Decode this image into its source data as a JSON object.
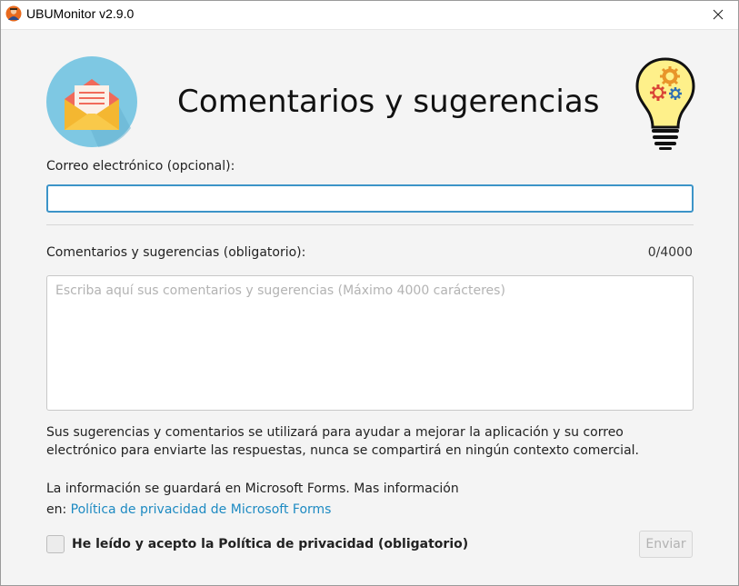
{
  "window": {
    "title": "UBUMonitor v2.9.0",
    "close_icon": "close-icon"
  },
  "header": {
    "title": "Comentarios y sugerencias",
    "left_icon": "envelope-icon",
    "right_icon": "lightbulb-gears-icon"
  },
  "form": {
    "email_label": "Correo electrónico (opcional):",
    "email_value": "",
    "comments_label": "Comentarios y sugerencias (obligatorio):",
    "counter": "0/4000",
    "comments_value": "",
    "comments_placeholder": "Escriba aquí sus comentarios y sugerencias (Máximo 4000 carácteres)",
    "notice_line1": "Sus sugerencias y comentarios se utilizará para ayudar a mejorar la aplicación y su correo",
    "notice_line2": "electrónico para enviarte las respuestas, nunca se compartirá en ningún contexto comercial.",
    "storage_line1": "La información se guardará en Microsoft Forms. Mas información",
    "storage_prefix": "en:",
    "privacy_link": "Política de privacidad de Microsoft Forms",
    "accept_label": "He leído y acepto la Política de privacidad (obligatorio)",
    "accept_checked": false,
    "send_label": "Enviar",
    "send_enabled": false
  },
  "colors": {
    "accent": "#3c94c8",
    "link": "#1d8ac2",
    "envelope_circle": "#7ec8e3",
    "envelope_body": "#f4b731",
    "envelope_flap": "#f06a5a",
    "bulb_yellow": "#fef08a"
  }
}
